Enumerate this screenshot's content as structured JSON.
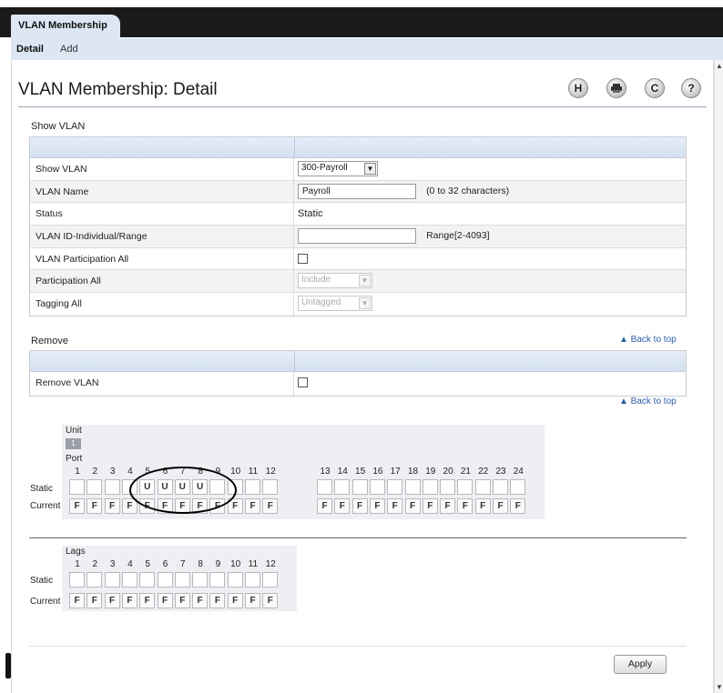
{
  "tabs": {
    "main": "VLAN Membership",
    "sub": [
      "Detail",
      "Add"
    ]
  },
  "page_title": "VLAN Membership: Detail",
  "toolbar_icons": [
    "H",
    "print-icon",
    "C",
    "?"
  ],
  "show_vlan": {
    "section": "Show VLAN",
    "rows": [
      {
        "label": "Show VLAN",
        "value": "300-Payroll",
        "kind": "select"
      },
      {
        "label": "VLAN Name",
        "value": "Payroll",
        "hint": "(0 to 32 characters)",
        "kind": "text"
      },
      {
        "label": "Status",
        "value": "Static",
        "kind": "plain"
      },
      {
        "label": "VLAN ID-Individual/Range",
        "value": "",
        "hint": "Range[2-4093]",
        "kind": "text"
      },
      {
        "label": "VLAN Participation All",
        "kind": "checkbox"
      },
      {
        "label": "Participation All",
        "value": "Include",
        "kind": "select-disabled"
      },
      {
        "label": "Tagging All",
        "value": "Untagged",
        "kind": "select-disabled"
      }
    ]
  },
  "remove": {
    "section": "Remove",
    "label": "Remove VLAN",
    "back_to_top": "▲ Back to top",
    "back_to_top_2": "▲ Back to top"
  },
  "ports": {
    "unit_label": "Unit",
    "unit_value": "1",
    "port_label": "Port",
    "static_label": "Static",
    "current_label": "Current",
    "numbers": [
      "1",
      "2",
      "3",
      "4",
      "5",
      "6",
      "7",
      "8",
      "9",
      "10",
      "11",
      "12",
      "13",
      "14",
      "15",
      "16",
      "17",
      "18",
      "19",
      "20",
      "21",
      "22",
      "23",
      "24"
    ],
    "static": [
      "",
      "",
      "",
      "",
      "U",
      "U",
      "U",
      "U",
      "",
      "",
      "",
      "",
      "",
      "",
      "",
      "",
      "",
      "",
      "",
      "",
      "",
      "",
      "",
      ""
    ],
    "current": [
      "F",
      "F",
      "F",
      "F",
      "F",
      "F",
      "F",
      "F",
      "F",
      "F",
      "F",
      "F",
      "F",
      "F",
      "F",
      "F",
      "F",
      "F",
      "F",
      "F",
      "F",
      "F",
      "F",
      "F"
    ]
  },
  "lags": {
    "label": "Lags",
    "static_label": "Static",
    "current_label": "Current",
    "numbers": [
      "1",
      "2",
      "3",
      "4",
      "5",
      "6",
      "7",
      "8",
      "9",
      "10",
      "11",
      "12"
    ],
    "static": [
      "",
      "",
      "",
      "",
      "",
      "",
      "",
      "",
      "",
      "",
      "",
      ""
    ],
    "current": [
      "F",
      "F",
      "F",
      "F",
      "F",
      "F",
      "F",
      "F",
      "F",
      "F",
      "F",
      "F"
    ]
  },
  "apply_label": "Apply"
}
